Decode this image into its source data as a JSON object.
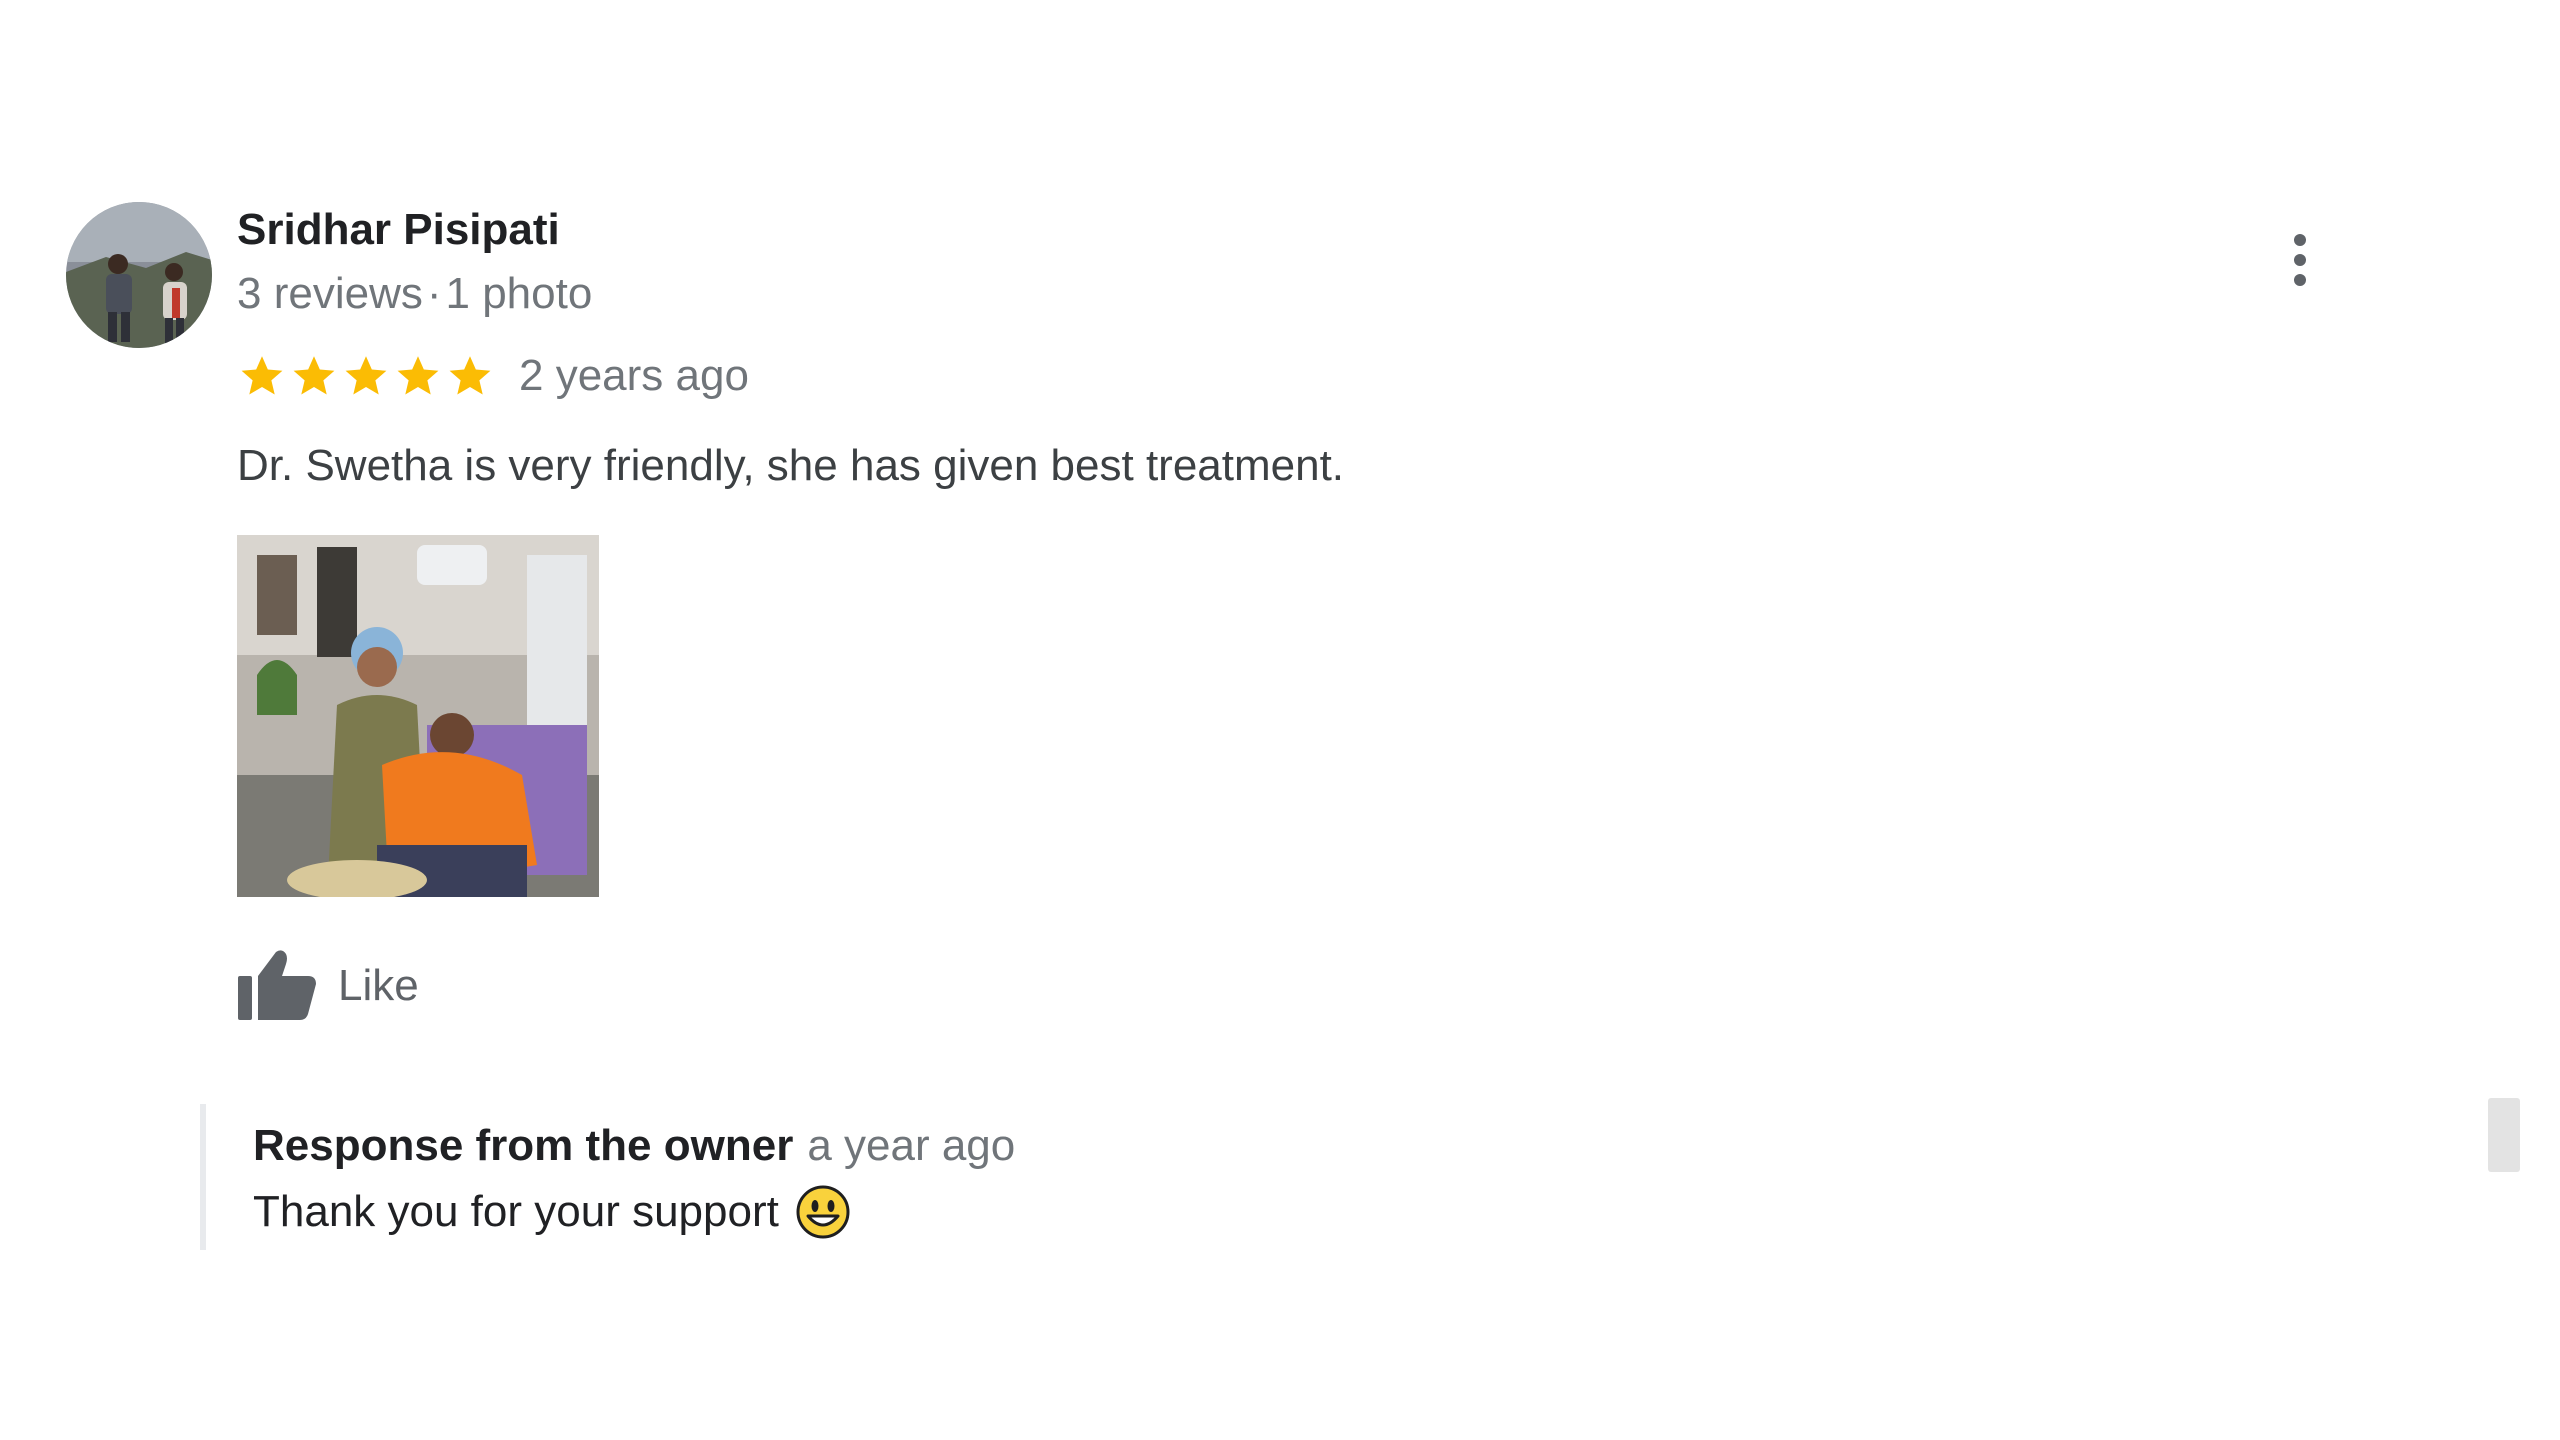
{
  "review": {
    "author": {
      "name": "Sridhar Pisipati",
      "reviews_count": "3 reviews",
      "separator": "·",
      "photos_count": "1 photo",
      "avatar_icon": "profile-photo"
    },
    "rating": 5,
    "max_rating": 5,
    "star_icon": "star-icon",
    "star_color": "#fbbc04",
    "time": "2 years ago",
    "text": "Dr. Swetha is very friendly, she has given best treatment.",
    "photo_icon": "review-photo",
    "like": {
      "icon": "thumb-up-icon",
      "label": "Like"
    },
    "more_icon": "more-vert-icon"
  },
  "owner_response": {
    "title": "Response from the owner",
    "time": "a year ago",
    "text": "Thank you for your support",
    "emoji": "grinning-face"
  },
  "colors": {
    "text_primary": "#202124",
    "text_secondary": "#70757a",
    "icon_gray": "#5f6368",
    "response_border": "#e8eaed"
  }
}
